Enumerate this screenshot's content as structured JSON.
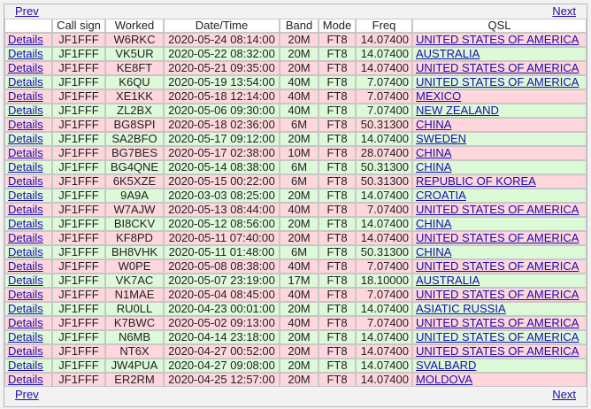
{
  "nav": {
    "prev": "Prev",
    "next": "Next"
  },
  "headers": [
    "",
    "Call sign",
    "Worked",
    "Date/Time",
    "Band",
    "Mode",
    "Freq",
    "QSL"
  ],
  "rows": [
    {
      "details": "Details",
      "call": "JF1FFF",
      "worked": "W6RKC",
      "dt": "2020-05-24 08:14:00",
      "band": "20M",
      "mode": "FT8",
      "freq": "14.07400",
      "qsl": "UNITED STATES OF AMERICA"
    },
    {
      "details": "Details",
      "call": "JF1FFF",
      "worked": "VK5UR",
      "dt": "2020-05-22 08:32:00",
      "band": "20M",
      "mode": "FT8",
      "freq": "14.07400",
      "qsl": "AUSTRALIA"
    },
    {
      "details": "Details",
      "call": "JF1FFF",
      "worked": "KE8FT",
      "dt": "2020-05-21 09:35:00",
      "band": "20M",
      "mode": "FT8",
      "freq": "14.07400",
      "qsl": "UNITED STATES OF AMERICA"
    },
    {
      "details": "Details",
      "call": "JF1FFF",
      "worked": "K6QU",
      "dt": "2020-05-19 13:54:00",
      "band": "40M",
      "mode": "FT8",
      "freq": "7.07400",
      "qsl": "UNITED STATES OF AMERICA"
    },
    {
      "details": "Details",
      "call": "JF1FFF",
      "worked": "XE1KK",
      "dt": "2020-05-18 12:14:00",
      "band": "40M",
      "mode": "FT8",
      "freq": "7.07400",
      "qsl": "MEXICO"
    },
    {
      "details": "Details",
      "call": "JF1FFF",
      "worked": "ZL2BX",
      "dt": "2020-05-06 09:30:00",
      "band": "40M",
      "mode": "FT8",
      "freq": "7.07400",
      "qsl": "NEW ZEALAND"
    },
    {
      "details": "Details",
      "call": "JF1FFF",
      "worked": "BG8SPI",
      "dt": "2020-05-18 02:36:00",
      "band": "6M",
      "mode": "FT8",
      "freq": "50.31300",
      "qsl": "CHINA"
    },
    {
      "details": "Details",
      "call": "JF1FFF",
      "worked": "SA2BFO",
      "dt": "2020-05-17 09:12:00",
      "band": "20M",
      "mode": "FT8",
      "freq": "14.07400",
      "qsl": "SWEDEN"
    },
    {
      "details": "Details",
      "call": "JF1FFF",
      "worked": "BG7BES",
      "dt": "2020-05-17 02:38:00",
      "band": "10M",
      "mode": "FT8",
      "freq": "28.07400",
      "qsl": "CHINA"
    },
    {
      "details": "Details",
      "call": "JF1FFF",
      "worked": "BG4QNE",
      "dt": "2020-05-14 08:38:00",
      "band": "6M",
      "mode": "FT8",
      "freq": "50.31300",
      "qsl": "CHINA"
    },
    {
      "details": "Details",
      "call": "JF1FFF",
      "worked": "6K5XZE",
      "dt": "2020-05-15 00:22:00",
      "band": "6M",
      "mode": "FT8",
      "freq": "50.31300",
      "qsl": "REPUBLIC OF KOREA"
    },
    {
      "details": "Details",
      "call": "JF1FFF",
      "worked": "9A9A",
      "dt": "2020-03-03 08:25:00",
      "band": "20M",
      "mode": "FT8",
      "freq": "14.07400",
      "qsl": "CROATIA"
    },
    {
      "details": "Details",
      "call": "JF1FFF",
      "worked": "W7AJW",
      "dt": "2020-05-13 08:44:00",
      "band": "40M",
      "mode": "FT8",
      "freq": "7.07400",
      "qsl": "UNITED STATES OF AMERICA"
    },
    {
      "details": "Details",
      "call": "JF1FFF",
      "worked": "BI8CKV",
      "dt": "2020-05-12 08:56:00",
      "band": "20M",
      "mode": "FT8",
      "freq": "14.07400",
      "qsl": "CHINA"
    },
    {
      "details": "Details",
      "call": "JF1FFF",
      "worked": "KF8PD",
      "dt": "2020-05-11 07:40:00",
      "band": "20M",
      "mode": "FT8",
      "freq": "14.07400",
      "qsl": "UNITED STATES OF AMERICA"
    },
    {
      "details": "Details",
      "call": "JF1FFF",
      "worked": "BH8VHK",
      "dt": "2020-05-11 01:48:00",
      "band": "6M",
      "mode": "FT8",
      "freq": "50.31300",
      "qsl": "CHINA"
    },
    {
      "details": "Details",
      "call": "JF1FFF",
      "worked": "W0PE",
      "dt": "2020-05-08 08:38:00",
      "band": "40M",
      "mode": "FT8",
      "freq": "7.07400",
      "qsl": "UNITED STATES OF AMERICA"
    },
    {
      "details": "Details",
      "call": "JF1FFF",
      "worked": "VK7AC",
      "dt": "2020-05-07 23:19:00",
      "band": "17M",
      "mode": "FT8",
      "freq": "18.10000",
      "qsl": "AUSTRALIA"
    },
    {
      "details": "Details",
      "call": "JF1FFF",
      "worked": "N1MAE",
      "dt": "2020-05-04 08:45:00",
      "band": "40M",
      "mode": "FT8",
      "freq": "7.07400",
      "qsl": "UNITED STATES OF AMERICA"
    },
    {
      "details": "Details",
      "call": "JF1FFF",
      "worked": "RU0LL",
      "dt": "2020-04-23 00:01:00",
      "band": "20M",
      "mode": "FT8",
      "freq": "14.07400",
      "qsl": "ASIATIC RUSSIA"
    },
    {
      "details": "Details",
      "call": "JF1FFF",
      "worked": "K7BWC",
      "dt": "2020-05-02 09:13:00",
      "band": "40M",
      "mode": "FT8",
      "freq": "7.07400",
      "qsl": "UNITED STATES OF AMERICA"
    },
    {
      "details": "Details",
      "call": "JF1FFF",
      "worked": "N6MB",
      "dt": "2020-04-14 23:18:00",
      "band": "20M",
      "mode": "FT8",
      "freq": "14.07400",
      "qsl": "UNITED STATES OF AMERICA"
    },
    {
      "details": "Details",
      "call": "JF1FFF",
      "worked": "NT6X",
      "dt": "2020-04-27 00:52:00",
      "band": "20M",
      "mode": "FT8",
      "freq": "14.07400",
      "qsl": "UNITED STATES OF AMERICA"
    },
    {
      "details": "Details",
      "call": "JF1FFF",
      "worked": "JW4PUA",
      "dt": "2020-04-27 09:08:00",
      "band": "20M",
      "mode": "FT8",
      "freq": "14.07400",
      "qsl": "SVALBARD"
    },
    {
      "details": "Details",
      "call": "JF1FFF",
      "worked": "ER2RM",
      "dt": "2020-04-25 12:57:00",
      "band": "20M",
      "mode": "FT8",
      "freq": "14.07400",
      "qsl": "MOLDOVA"
    }
  ],
  "row_colors": {
    "odd": "#ffd6dc",
    "even": "#dcf9d8"
  }
}
